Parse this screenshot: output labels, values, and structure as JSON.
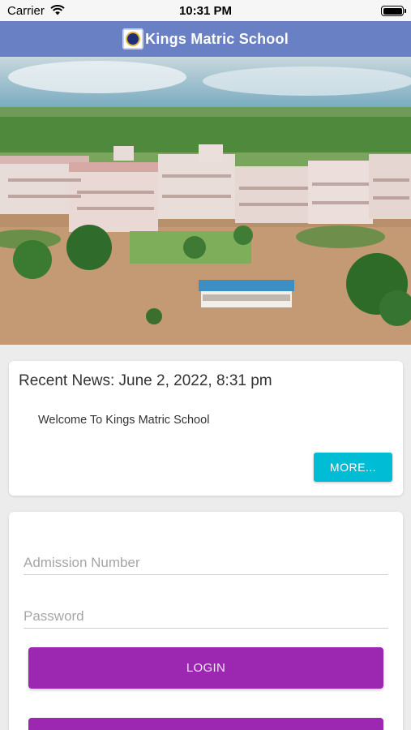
{
  "status_bar": {
    "carrier": "Carrier",
    "time": "10:31 PM",
    "icons": [
      "wifi-icon",
      "battery-icon"
    ]
  },
  "header": {
    "title": "Kings Matric School",
    "logo": "school-crest-logo"
  },
  "news": {
    "heading": "Recent News: June 2, 2022, 8:31 pm",
    "body": "Welcome To Kings Matric School",
    "more_label": "MORE..."
  },
  "login": {
    "admission_placeholder": "Admission Number",
    "admission_value": "",
    "password_placeholder": "Password",
    "password_value": "",
    "login_label": "LOGIN"
  },
  "colors": {
    "nav": "#6a80c4",
    "accent": "#00bcd4",
    "primary": "#9c27b0"
  }
}
